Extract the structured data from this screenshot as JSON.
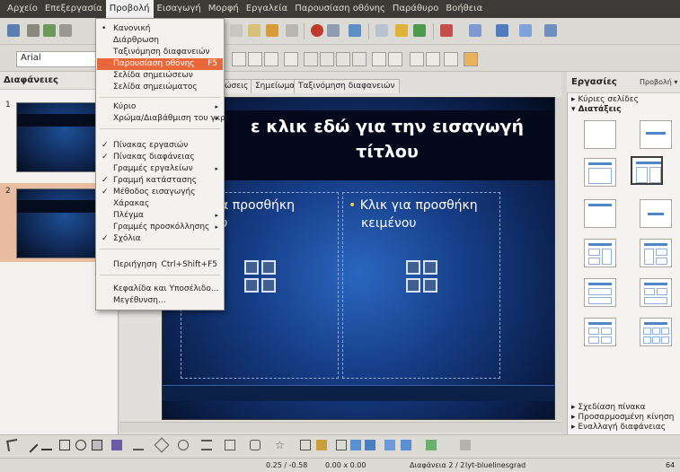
{
  "menubar": {
    "items": [
      "Αρχείο",
      "Επεξεργασία",
      "Προβολή",
      "Εισαγωγή",
      "Μορφή",
      "Εργαλεία",
      "Παρουσίαση οθόνης",
      "Παράθυρο",
      "Βοήθεια"
    ],
    "active_index": 2
  },
  "toolbar": {
    "font_name": "Arial"
  },
  "left_panel": {
    "title": "Διαφάνειες",
    "slide_numbers": [
      "1",
      "2"
    ]
  },
  "view_tabs": [
    "ώσεις",
    "Σημείωμα",
    "Ταξινόμηση διαφανειών"
  ],
  "slide": {
    "title_line1": "ε κλικ εδώ για την εισαγωγή",
    "title_line2": "τίτλου",
    "left_text_line1": "για προσθήκη",
    "left_text_line2": "ιου",
    "right_text_line1": "Κλικ για προσθήκη",
    "right_text_line2": "κειμένου",
    "bullet": "•"
  },
  "view_menu": {
    "items": [
      {
        "label": "Κανονική",
        "mark": "•",
        "shortcut": "",
        "submenu": false
      },
      {
        "label": "Διάρθρωση",
        "mark": "",
        "shortcut": "",
        "submenu": false
      },
      {
        "label": "Ταξινόμηση διαφανειών",
        "mark": "",
        "shortcut": "",
        "submenu": false
      },
      {
        "label": "Παρουσίαση οθόνης",
        "mark": "",
        "shortcut": "F5",
        "submenu": false,
        "highlighted": true
      },
      {
        "label": "Σελίδα σημειώσεων",
        "mark": "",
        "shortcut": "",
        "submenu": false
      },
      {
        "label": "Σελίδα σημειώματος",
        "mark": "",
        "shortcut": "",
        "submenu": false
      },
      {
        "label": "Κύριο",
        "mark": "",
        "shortcut": "",
        "submenu": true
      },
      {
        "label": "Χρώμα/Διαβάθμιση του γκρι",
        "mark": "",
        "shortcut": "",
        "submenu": true
      },
      {
        "label": "Πίνακας εργασιών",
        "mark": "✓",
        "shortcut": "",
        "submenu": false
      },
      {
        "label": "Πίνακας διαφάνειας",
        "mark": "✓",
        "shortcut": "",
        "submenu": false
      },
      {
        "label": "Γραμμές εργαλείων",
        "mark": "",
        "shortcut": "",
        "submenu": true
      },
      {
        "label": "Γραμμή κατάστασης",
        "mark": "✓",
        "shortcut": "",
        "submenu": false
      },
      {
        "label": "Μέθοδος εισαγωγής",
        "mark": "✓",
        "shortcut": "",
        "submenu": false
      },
      {
        "label": "Χάρακας",
        "mark": "",
        "shortcut": "",
        "submenu": false
      },
      {
        "label": "Πλέγμα",
        "mark": "",
        "shortcut": "",
        "submenu": true
      },
      {
        "label": "Γραμμές προσκόλλησης",
        "mark": "",
        "shortcut": "",
        "submenu": true
      },
      {
        "label": "Σχόλια",
        "mark": "✓",
        "shortcut": "",
        "submenu": false
      },
      {
        "label": "Περιήγηση",
        "mark": "",
        "shortcut": "Ctrl+Shift+F5",
        "submenu": false
      },
      {
        "label": "Κεφαλίδα και Υποσέλιδο...",
        "mark": "",
        "shortcut": "",
        "submenu": false
      },
      {
        "label": "Μεγέθυνση...",
        "mark": "",
        "shortcut": "",
        "submenu": false
      }
    ],
    "submenu_arrow": "▸"
  },
  "right_panel": {
    "title": "Εργασίες",
    "view_label": "Προβολή ▾",
    "section_master": "▸ Κύριες σελίδες",
    "section_layouts": "▾ Διατάξεις",
    "section_table": "▸ Σχεδίαση πίνακα",
    "section_animation": "▸ Προσαρμοσμένη κίνηση",
    "section_transition": "▸ Εναλλαγή διαφάνειας"
  },
  "statusbar": {
    "position": "0.25 / -0.58",
    "size": "0.00 x 0.00",
    "slide_info": "Διαφάνεια 2 / 2",
    "master_name": "lyt-bluelinesgrad",
    "zoom": "64"
  },
  "colors": {
    "menubar_bg": "#3c3b37",
    "highlight": "#e8683c",
    "slide_blue": "#163d86",
    "thumb_selected": "#e9bca2"
  }
}
